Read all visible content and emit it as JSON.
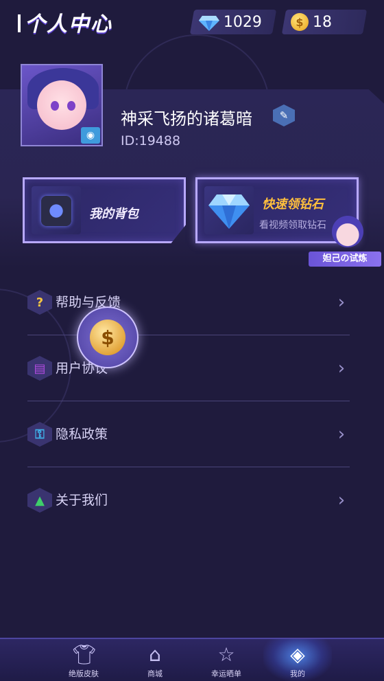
{
  "header": {
    "title": "个人中心",
    "diamonds": "1029",
    "coins": "18",
    "diamond_icon": "diamond-icon",
    "coin_icon": "coin-icon"
  },
  "profile": {
    "nickname": "神采飞扬的诸葛暗",
    "id": "ID:19488"
  },
  "actions": {
    "bag": {
      "title": "我的背包"
    },
    "diamond": {
      "title": "快速领钻石",
      "subtitle": "看视频领取钻石"
    }
  },
  "trial_badge": {
    "label": "妲己の试炼"
  },
  "menu": [
    {
      "label": "帮助与反馈",
      "icon": "question-icon",
      "color": "#f5c542"
    },
    {
      "label": "用户协议",
      "icon": "document-icon",
      "color": "#b04be0"
    },
    {
      "label": "隐私政策",
      "icon": "lock-icon",
      "color": "#3fb0e8"
    },
    {
      "label": "关于我们",
      "icon": "warning-icon",
      "color": "#3ecf6a"
    }
  ],
  "nav": [
    {
      "label": "绝版皮肤",
      "icon": "shirt-icon"
    },
    {
      "label": "商城",
      "icon": "shop-icon"
    },
    {
      "label": "幸运晒单",
      "icon": "star-icon"
    },
    {
      "label": "我的",
      "icon": "diamond-nav-icon",
      "active": true
    }
  ],
  "colors": {
    "background": "#1f1b3d",
    "card_border": "#b8a9ff",
    "accent_gold": "#ffbf3d",
    "nav_active": "#4c7fe0"
  }
}
